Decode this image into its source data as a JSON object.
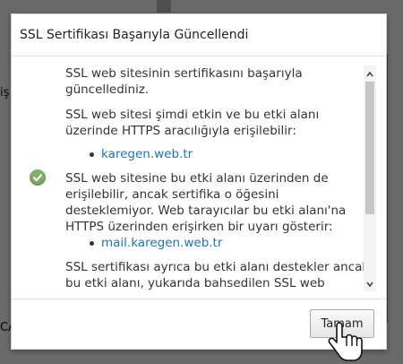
{
  "background": {
    "left_text": "iş",
    "bottom_text": "CA"
  },
  "dialog": {
    "title": "SSL Sertifikası Başarıyla Güncellendi",
    "status_icon": "check-circle-icon",
    "paragraphs": {
      "p1": "SSL web sitesinin sertifikasını başarıyla güncellediniz.",
      "p2": "SSL web sitesi şimdi etkin ve bu etki alanı üzerinde HTTPS aracılığıyla erişilebilir:",
      "p3": "SSL web sitesine bu etki alanı üzerinden de erişilebilir, ancak sertifika o öğesini desteklemiyor. Web tarayıcılar bu etki alanı'na HTTPS üzerinden erişirken bir uyarı gösterir:",
      "p4": "SSL sertifikası ayrıca bu etki alanı destekler ancak bu etki alanı, yukarıda bahsedilen SSL web"
    },
    "links": {
      "domain_primary": "karegen.web.tr",
      "domain_mail": "mail.karegen.web.tr"
    },
    "ok_button_label": "Tamam"
  },
  "colors": {
    "link": "#1c76b3",
    "success": "#82b06b"
  }
}
